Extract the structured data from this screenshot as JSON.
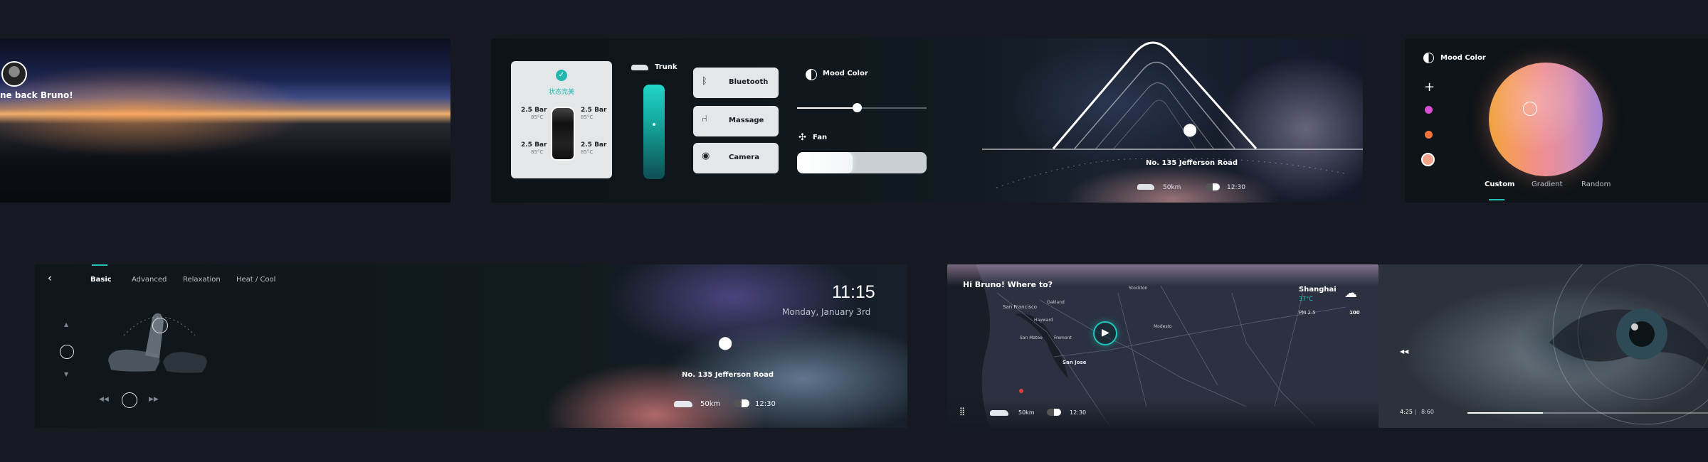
{
  "welcome": {
    "greeting": "ne back Bruno!"
  },
  "control": {
    "status": "状态完美",
    "tires": [
      {
        "pressure": "2.5 Bar",
        "temp": "85°C"
      },
      {
        "pressure": "2.5 Bar",
        "temp": "85°C"
      },
      {
        "pressure": "2.5 Bar",
        "temp": "85°C"
      },
      {
        "pressure": "2.5 Bar",
        "temp": "85°C"
      }
    ],
    "trunk_label": "Trunk",
    "buttons": [
      "Bluetooth",
      "Massage",
      "Camera"
    ],
    "mood_color_label": "Mood Color",
    "fan_label": "Fan",
    "nav": {
      "address": "No. 135 Jefferson Road",
      "distance": "50km",
      "eta": "12:30"
    }
  },
  "mood": {
    "title": "Mood Color",
    "add_icon": "+",
    "tabs": [
      "Custom",
      "Gradient",
      "Random"
    ],
    "swatches": [
      "#d84fd6",
      "#f2743a",
      "#f0a58a"
    ]
  },
  "seat": {
    "tabs": [
      "Basic",
      "Advanced",
      "Relaxation",
      "Heat / Cool"
    ],
    "time": "11:15",
    "date": "Monday, January 3rd",
    "address": "No. 135 Jefferson Road",
    "distance": "50km",
    "eta": "12:30"
  },
  "map": {
    "greeting": "Hi Bruno! Where to?",
    "city": "Shanghai",
    "temp": "37°C",
    "pm_label": "PM 2.5",
    "pm_value": "100",
    "distance": "50km",
    "eta": "12:30",
    "places": [
      "San Francisco",
      "San Mateo",
      "Fremont",
      "Hayward",
      "Oakland",
      "San Jose",
      "Modesto",
      "Stockton"
    ]
  },
  "video": {
    "elapsed": "4:25",
    "total": "8:60"
  }
}
